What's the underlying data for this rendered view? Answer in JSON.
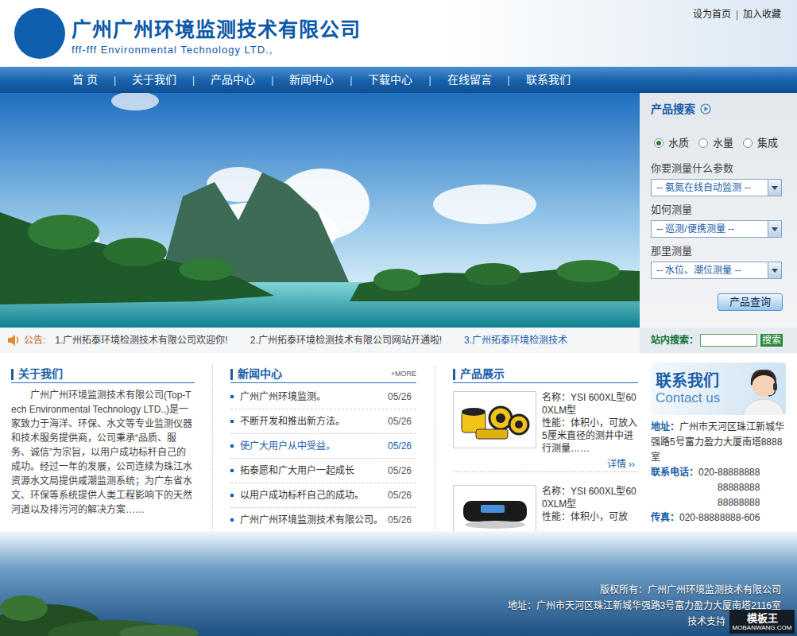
{
  "header": {
    "title": "广州广州环境监测技术有限公司",
    "subtitle": "fff-fff Environmental Technology LTD.,",
    "top_links": [
      "设为首页",
      "加入收藏"
    ],
    "top_separator": "|"
  },
  "nav": {
    "items": [
      "首 页",
      "关于我们",
      "产品中心",
      "新闻中心",
      "下载中心",
      "在线留言",
      "联系我们"
    ],
    "separator": "|"
  },
  "product_search": {
    "title": "产品搜索",
    "categories": [
      {
        "label": "水质",
        "selected": true
      },
      {
        "label": "水量",
        "selected": false
      },
      {
        "label": "集成",
        "selected": false
      }
    ],
    "fields": [
      {
        "label": "你要测量什么参数",
        "value": "-- 氨氮在线自动监测 --"
      },
      {
        "label": "如何测量",
        "value": "-- 巡测/便携测量 --"
      },
      {
        "label": "那里测量",
        "value": "-- 水位、潮位测量 --"
      }
    ],
    "button": "产品查询"
  },
  "notice": {
    "label": "公告:",
    "items": [
      {
        "text": "1.广州拓泰环境检测技术有限公司欢迎你!",
        "highlighted": false
      },
      {
        "text": "2.广州拓泰环境检测技术有限公司网站开通啦!",
        "highlighted": false
      },
      {
        "text": "3.广州拓泰环境检测技术",
        "highlighted": true
      }
    ]
  },
  "site_search": {
    "label": "站内搜索：",
    "button": "搜索"
  },
  "about": {
    "title": "关于我们",
    "text": "广州广州环境监测技术有限公司(Top-Tech Environmental Technology LTD.,)是一家致力于海洋、环保、水文等专业监测仪器和技术服务提供商，公司秉承“品质、服务、诚信”为宗旨，以用户成功标杆自己的成功。经过一年的发展，公司连续为珠江水资源水文局提供咸潮监测系统；为广东省水文、环保等系统提供人类工程影响下的天然河道以及排污河的解决方案……"
  },
  "news": {
    "title": "新闻中心",
    "more": "+MORE",
    "items": [
      {
        "title": "广州广州环境监测。",
        "date": "05/26",
        "highlighted": false
      },
      {
        "title": "不断开发和推出新方法。",
        "date": "05/26",
        "highlighted": false
      },
      {
        "title": "使广大用户从中受益。",
        "date": "05/26",
        "highlighted": true
      },
      {
        "title": "拓泰愿和广大用户一起成长",
        "date": "05/26",
        "highlighted": false
      },
      {
        "title": "以用户成功标杆自己的成功。",
        "date": "05/26",
        "highlighted": false
      },
      {
        "title": "广州广州环境监测技术有限公司。",
        "date": "05/26",
        "highlighted": false
      }
    ]
  },
  "products": {
    "title": "产品展示",
    "items": [
      {
        "kind": "sonde",
        "name": "名称：YSI 600XL型600XLM型",
        "desc": "性能：体积小，可放入5厘米直径的测井中进行测量……",
        "detail": "详情 ››"
      },
      {
        "kind": "handheld",
        "name": "名称：YSI 600XL型600XLM型",
        "desc": "性能：体积小，可放"
      }
    ]
  },
  "contact": {
    "banner_title": "联系我们",
    "banner_subtitle": "Contact us",
    "address_label": "地址：",
    "address": "广州市天河区珠江新城华强路5号富力盈力大厦南塔8888室",
    "phone_label": "联系电话：",
    "phones": [
      "020-88888888",
      "88888888",
      "88888888"
    ],
    "fax_label": "传真：",
    "fax": "020-88888888-606"
  },
  "footer": {
    "lines": [
      "版权所有：广州广州环境监测技术有限公司",
      "地址：广州市天河区珠江新城华强路3号富力盈力大厦南塔2116室",
      "技术支持"
    ]
  },
  "watermark": {
    "title": "模板王",
    "url": "MOBANWANG.COM"
  }
}
